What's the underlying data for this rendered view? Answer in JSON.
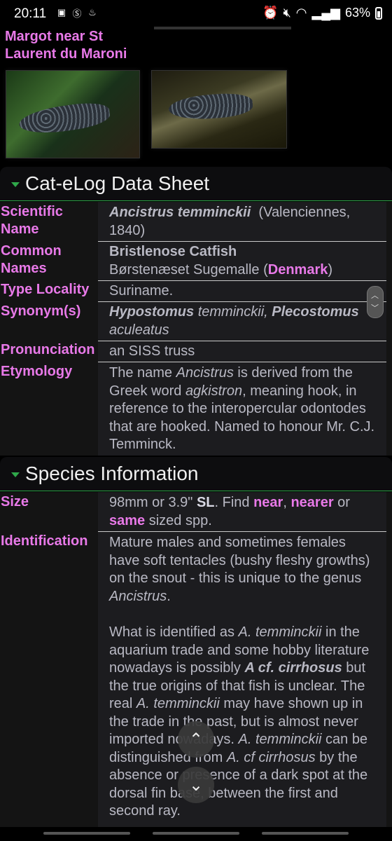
{
  "status": {
    "time": "20:11",
    "battery": "63%"
  },
  "header_caption": "Margot near St Laurent du Maroni",
  "photos": [
    "photo-1",
    "photo-2"
  ],
  "datasheet": {
    "title": "Cat-eLog Data Sheet",
    "scientific_name": {
      "label": "Scientific Name",
      "genus_species": "Ancistrus temminckii",
      "author": "(Valenciennes, 1840)"
    },
    "common_names": {
      "label": "Common Names",
      "primary": "Bristlenose Catfish",
      "other": "Børstenæset Sugemalle",
      "country": "Denmark"
    },
    "type_locality": {
      "label": "Type Locality",
      "value": "Suriname."
    },
    "synonyms": {
      "label": "Synonym(s)",
      "genus1": "Hypostomus",
      "species1": "temminckii,",
      "genus2": "Plecostomus",
      "species2": "aculeatus"
    },
    "pronunciation": {
      "label": "Pronunciation",
      "value": "an SISS truss"
    },
    "etymology": {
      "label": "Etymology",
      "p1": "The name ",
      "genus": "Ancistrus",
      "p2": " is derived from the Greek word ",
      "word": "agkistron",
      "p3": ", meaning hook, in reference to the interopercular odontodes that are hooked. Named to honour Mr. C.J. Temminck."
    }
  },
  "species_info": {
    "title": "Species Information",
    "size": {
      "label": "Size",
      "text": "98mm or 3.9\"",
      "sl": "SL",
      "find": ". Find ",
      "near": "near",
      "nearer": "nearer",
      "or": " or",
      "same": "same",
      "tail": " sized spp."
    },
    "identification": {
      "label": "Identification",
      "p1a": "Mature males and sometimes females have soft tentacles (bushy fleshy growths) on the snout - this is unique to the genus ",
      "p1genus": "Ancistrus",
      "p1end": ".",
      "p2a": "What is identified as ",
      "p2sp": "A. temminckii",
      "p2b": " in the aquarium trade and some hobby literature nowadays is possibly ",
      "p2link": "A cf. cirrhosus",
      "p2c": " but the true origins of that fish is unclear. The real ",
      "p2sp2": "A. temminckii",
      "p2d": " may have shown up in the trade in the past, but is almost never imported nowadays. ",
      "p2sp3": "A. temminckii",
      "p2e": " can be distinguished from ",
      "p2sp4": "A. cf cirrhosus",
      "p2f": " by the absence or presence of a dark spot at the dorsal fin base, between the first and second ray."
    }
  }
}
